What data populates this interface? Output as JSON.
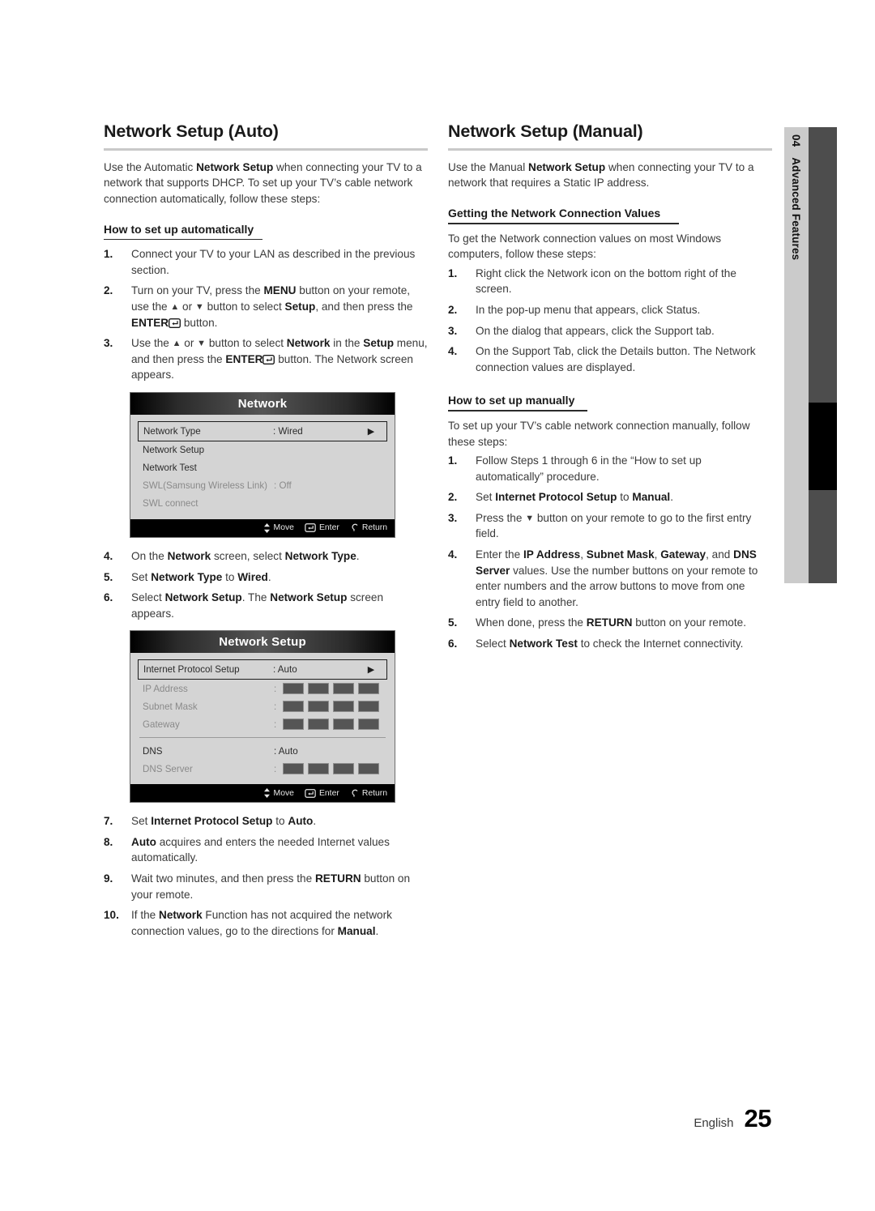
{
  "page": {
    "language": "English",
    "number": "25",
    "side_tab": {
      "chapter_number": "04",
      "chapter_title": "Advanced Features"
    }
  },
  "left_column": {
    "heading": "Network Setup (Auto)",
    "intro": "Use the Automatic Network Setup when connecting your TV to a network that supports DHCP. To set up your TV’s cable network connection automatically, follow these steps:",
    "intro_parts": {
      "a": "Use the Automatic ",
      "b": "Network Setup",
      "c": " when connecting your TV to a network that supports DHCP. To set up your TV’s cable network connection automatically, follow these steps:"
    },
    "subheading": "How to set up automatically",
    "steps": {
      "s1_num": "1.",
      "s1_text": "Connect your TV to your LAN as described in the previous section.",
      "s2_num": "2.",
      "s2_a": "Turn on your TV, press the ",
      "s2_menu": "MENU",
      "s2_b": " button on your remote, use the ",
      "s2_c": " or ",
      "s2_d": " button to select ",
      "s2_setup": "Setup",
      "s2_e": ", and then press the ",
      "s2_enter": "ENTER",
      "s2_f": " button.",
      "s3_num": "3.",
      "s3_a": "Use the ",
      "s3_b": " or ",
      "s3_c": " button to select ",
      "s3_network": "Network",
      "s3_d": " in the ",
      "s3_setup": "Setup",
      "s3_e": " menu, and then press the ",
      "s3_enter": "ENTER",
      "s3_f": " button. The Network screen appears.",
      "s4_num": "4.",
      "s4_a": "On the ",
      "s4_b": "Network",
      "s4_c": " screen, select ",
      "s4_d": "Network Type",
      "s4_e": ".",
      "s5_num": "5.",
      "s5_a": "Set ",
      "s5_b": "Network Type",
      "s5_c": " to ",
      "s5_d": "Wired",
      "s5_e": ".",
      "s6_num": "6.",
      "s6_a": "Select ",
      "s6_b": "Network Setup",
      "s6_c": ". The ",
      "s6_d": "Network Setup",
      "s6_e": " screen appears.",
      "s7_num": "7.",
      "s7_a": "Set ",
      "s7_b": "Internet Protocol Setup",
      "s7_c": " to ",
      "s7_d": "Auto",
      "s7_e": ".",
      "s8_num": "8.",
      "s8_a": "Auto",
      "s8_b": " acquires and enters the needed Internet values automatically.",
      "s9_num": "9.",
      "s9_a": "Wait two minutes, and then press the ",
      "s9_b": "RETURN",
      "s9_c": " button on your remote.",
      "s10_num": "10.",
      "s10_a": "If the ",
      "s10_b": "Network",
      "s10_c": " Function has not acquired the network connection values, go to the directions for ",
      "s10_d": "Manual",
      "s10_e": "."
    }
  },
  "right_column": {
    "heading": "Network Setup (Manual)",
    "intro_a": "Use the Manual ",
    "intro_b": "Network Setup",
    "intro_c": " when connecting your TV to a network that requires a Static IP address.",
    "subheading_values": "Getting the Network Connection Values",
    "values_intro": "To get the Network connection values on most Windows computers, follow these steps:",
    "value_steps": [
      {
        "num": "1.",
        "text": "Right click the Network icon on the bottom right of the screen."
      },
      {
        "num": "2.",
        "text": "In the pop-up menu that appears, click Status."
      },
      {
        "num": "3.",
        "text": "On the dialog that appears, click the Support tab."
      },
      {
        "num": "4.",
        "text": "On the Support Tab, click the Details button. The Network connection values are displayed."
      }
    ],
    "subheading_manual": "How to set up manually",
    "manual_intro": "To set up your TV’s cable network connection manually, follow these steps:",
    "manual_steps": {
      "m1_num": "1.",
      "m1_text": "Follow Steps 1 through 6 in the “How to set up automatically” procedure.",
      "m2_num": "2.",
      "m2_a": "Set ",
      "m2_b": "Internet Protocol Setup",
      "m2_c": " to ",
      "m2_d": "Manual",
      "m2_e": ".",
      "m3_num": "3.",
      "m3_a": "Press the ",
      "m3_b": " button on your remote to go to the first entry field.",
      "m4_num": "4.",
      "m4_a": "Enter the ",
      "m4_b": "IP Address",
      "m4_c": ", ",
      "m4_d": "Subnet Mask",
      "m4_e": ", ",
      "m4_f": "Gateway",
      "m4_g": ", and ",
      "m4_h": "DNS Server",
      "m4_i": " values. Use the number buttons on your remote to enter numbers and the arrow buttons to move from one entry field to another.",
      "m5_num": "5.",
      "m5_a": "When done, press the ",
      "m5_b": "RETURN",
      "m5_c": " button on your remote.",
      "m6_num": "6.",
      "m6_a": "Select ",
      "m6_b": "Network Test",
      "m6_c": " to check the Internet connectivity."
    }
  },
  "osd_network": {
    "title": "Network",
    "rows": [
      {
        "label": "Network Type",
        "value": ": Wired",
        "selected": true,
        "chevron": "▶",
        "dim": false
      },
      {
        "label": "Network Setup",
        "value": "",
        "selected": false,
        "chevron": "",
        "dim": false
      },
      {
        "label": "Network Test",
        "value": "",
        "selected": false,
        "chevron": "",
        "dim": false
      },
      {
        "label": "SWL(Samsung Wireless Link)",
        "value": ": Off",
        "selected": false,
        "chevron": "",
        "dim": true
      },
      {
        "label": "SWL connect",
        "value": "",
        "selected": false,
        "chevron": "",
        "dim": true
      }
    ],
    "footer": {
      "move": "Move",
      "enter": "Enter",
      "return": "Return"
    }
  },
  "osd_network_setup": {
    "title": "Network Setup",
    "rows": [
      {
        "label": "Internet Protocol Setup",
        "value": ": Auto",
        "type": "value",
        "selected": true,
        "chevron": "▶",
        "dim": false
      },
      {
        "label": "IP Address",
        "value": ":",
        "type": "octets",
        "selected": false,
        "chevron": "",
        "dim": true
      },
      {
        "label": "Subnet Mask",
        "value": ":",
        "type": "octets",
        "selected": false,
        "chevron": "",
        "dim": true
      },
      {
        "label": "Gateway",
        "value": ":",
        "type": "octets",
        "selected": false,
        "chevron": "",
        "dim": true
      },
      {
        "label": "DNS",
        "value": ": Auto",
        "type": "value",
        "selected": false,
        "chevron": "",
        "dim": false
      },
      {
        "label": "DNS Server",
        "value": ":",
        "type": "octets",
        "selected": false,
        "chevron": "",
        "dim": true
      }
    ],
    "footer": {
      "move": "Move",
      "enter": "Enter",
      "return": "Return"
    }
  },
  "glyphs": {
    "arrow_up": "▲",
    "arrow_down": "▼",
    "chevron_right": "▶",
    "enter_key": "enter-key-icon",
    "move_arrows": "up-down-arrow-icon",
    "return_arrow": "return-arrow-icon"
  }
}
